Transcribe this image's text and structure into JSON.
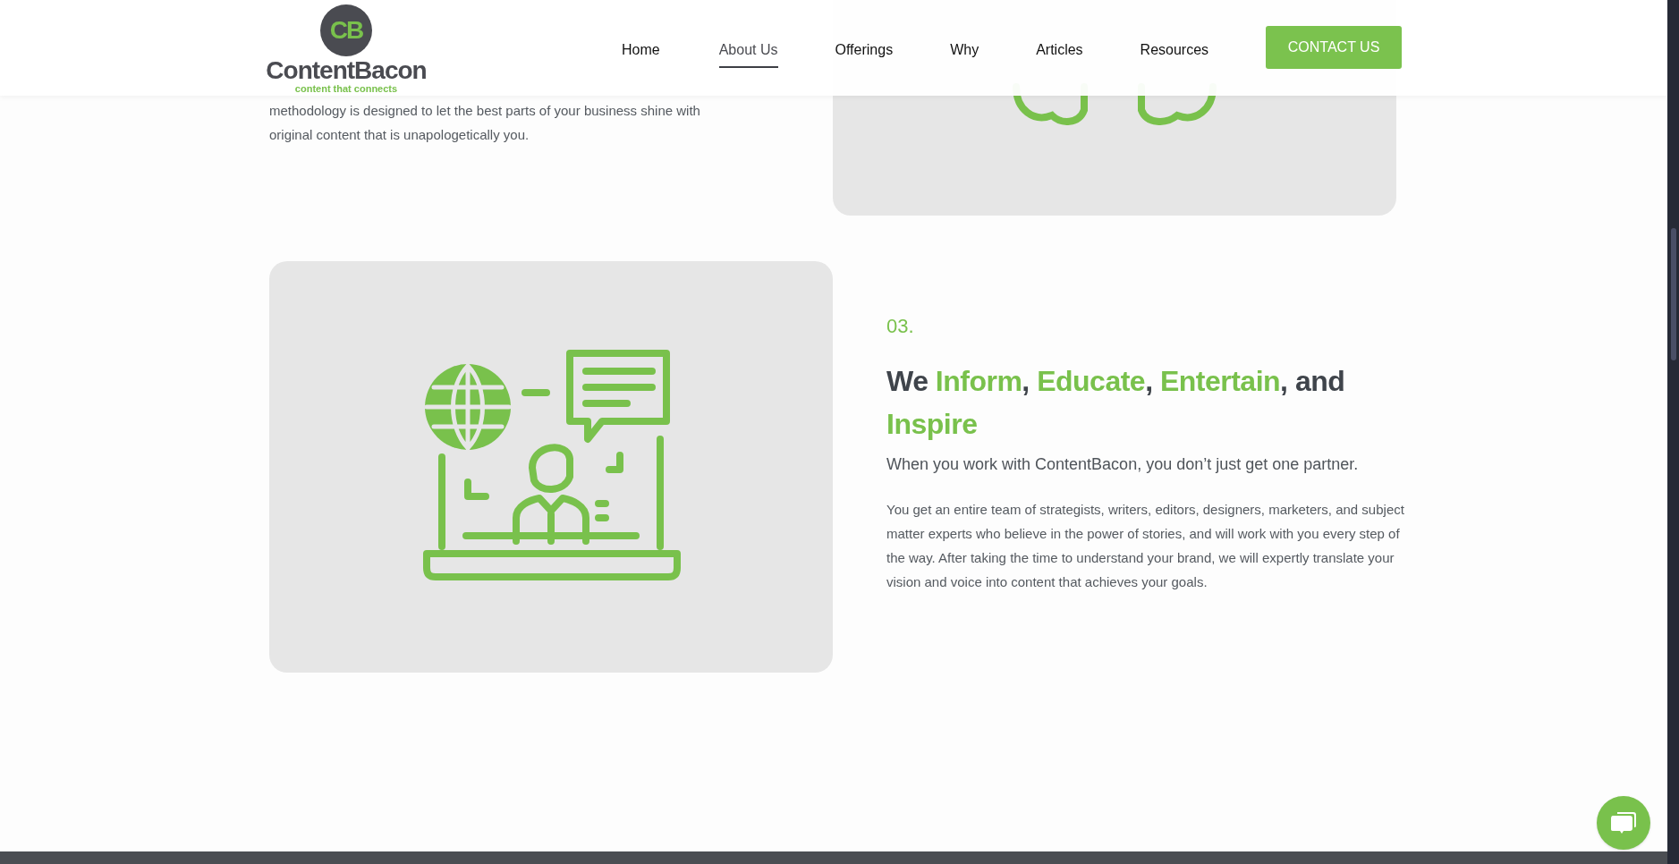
{
  "header": {
    "logo": {
      "monogram": "CB",
      "wordmark": "ContentBacon",
      "tagline": "content that connects"
    },
    "nav": [
      {
        "label": "Home",
        "selected": false
      },
      {
        "label": "About Us",
        "selected": true
      },
      {
        "label": "Offerings",
        "selected": false
      },
      {
        "label": "Why",
        "selected": false
      },
      {
        "label": "Articles",
        "selected": false
      },
      {
        "label": "Resources",
        "selected": false
      }
    ],
    "cta": "CONTACT US"
  },
  "intro": {
    "lines": [
      "methodology is designed to let the best parts of your business shine with",
      "original content that is unapologetically you."
    ]
  },
  "section": {
    "number": "03.",
    "heading": [
      {
        "text": "We ",
        "accent": false
      },
      {
        "text": "Inform",
        "accent": true
      },
      {
        "text": ", ",
        "accent": false
      },
      {
        "text": "Educate",
        "accent": true
      },
      {
        "text": ", ",
        "accent": false
      },
      {
        "text": "Entertain",
        "accent": true
      },
      {
        "text": ", and ",
        "accent": false
      },
      {
        "text": "Inspire",
        "accent": true
      }
    ],
    "subtitle": "When you work with ContentBacon, you don’t just get one partner.",
    "body": "You get an entire team of strategists, writers, editors, designers, marketers, and subject matter experts who believe in the power of stories, and will work with you every step of the way. After taking the time to understand your brand, we will expertly translate your vision and voice into content that achieves your goals."
  }
}
